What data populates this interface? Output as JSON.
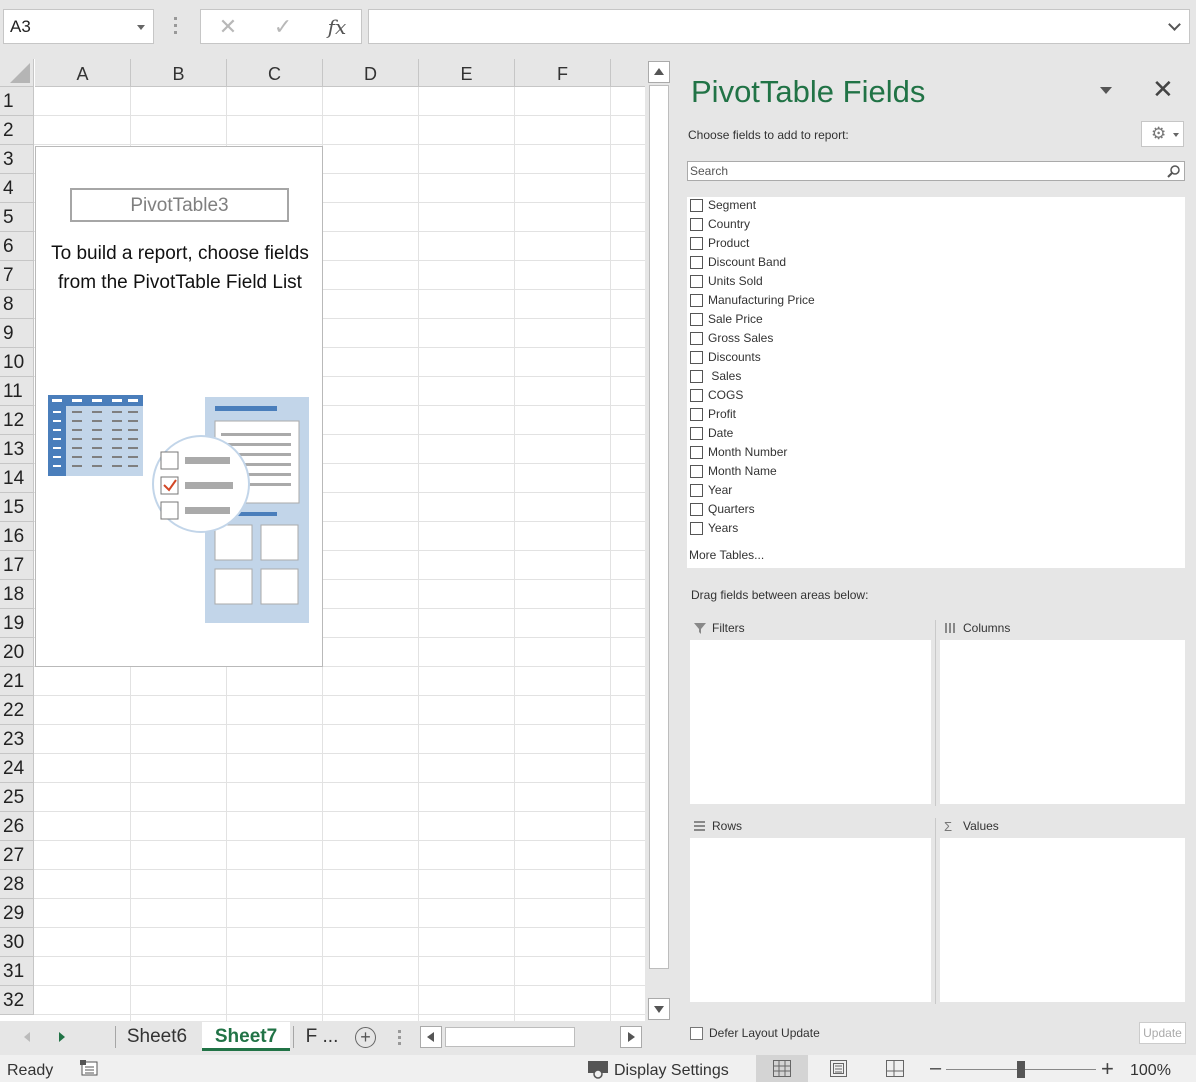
{
  "formula_bar": {
    "name_box": "A3",
    "cancel_glyph": "✕",
    "enter_glyph": "✓",
    "function_glyph": "fx",
    "formula_value": ""
  },
  "grid": {
    "columns": [
      "A",
      "B",
      "C",
      "D",
      "E",
      "F"
    ],
    "rows": [
      "1",
      "2",
      "3",
      "4",
      "5",
      "6",
      "7",
      "8",
      "9",
      "10",
      "11",
      "12",
      "13",
      "14",
      "15",
      "16",
      "17",
      "18",
      "19",
      "20",
      "21",
      "22",
      "23",
      "24",
      "25",
      "26",
      "27",
      "28",
      "29",
      "30",
      "31",
      "32"
    ],
    "selected_cell": "A3"
  },
  "pivot_placeholder": {
    "name": "PivotTable3",
    "message": "To build a report, choose fields from the PivotTable Field List"
  },
  "field_panel": {
    "title": "PivotTable Fields",
    "choose_label": "Choose fields to add to report:",
    "search_placeholder": "Search",
    "fields": [
      "Segment",
      "Country",
      "Product",
      "Discount Band",
      "Units Sold",
      "Manufacturing Price",
      "Sale Price",
      "Gross Sales",
      "Discounts",
      " Sales",
      "COGS",
      "Profit",
      "Date",
      "Month Number",
      "Month Name",
      "Year",
      "Quarters",
      "Years"
    ],
    "more_tables": "More Tables...",
    "drag_label": "Drag fields between areas below:",
    "areas": {
      "filters": "Filters",
      "columns": "Columns",
      "rows": "Rows",
      "values": "Values"
    },
    "defer_label": "Defer Layout Update",
    "update_label": "Update"
  },
  "sheet_tabs": {
    "tabs": [
      "Sheet6",
      "Sheet7",
      "F ..."
    ],
    "active": "Sheet7"
  },
  "status_bar": {
    "ready": "Ready",
    "display_settings": "Display Settings",
    "zoom": "100%"
  },
  "colors": {
    "accent": "#217346",
    "placeholder_blue": "#4a7ebb",
    "placeholder_light_blue": "#c2d5e9",
    "check_red": "#d24726"
  }
}
